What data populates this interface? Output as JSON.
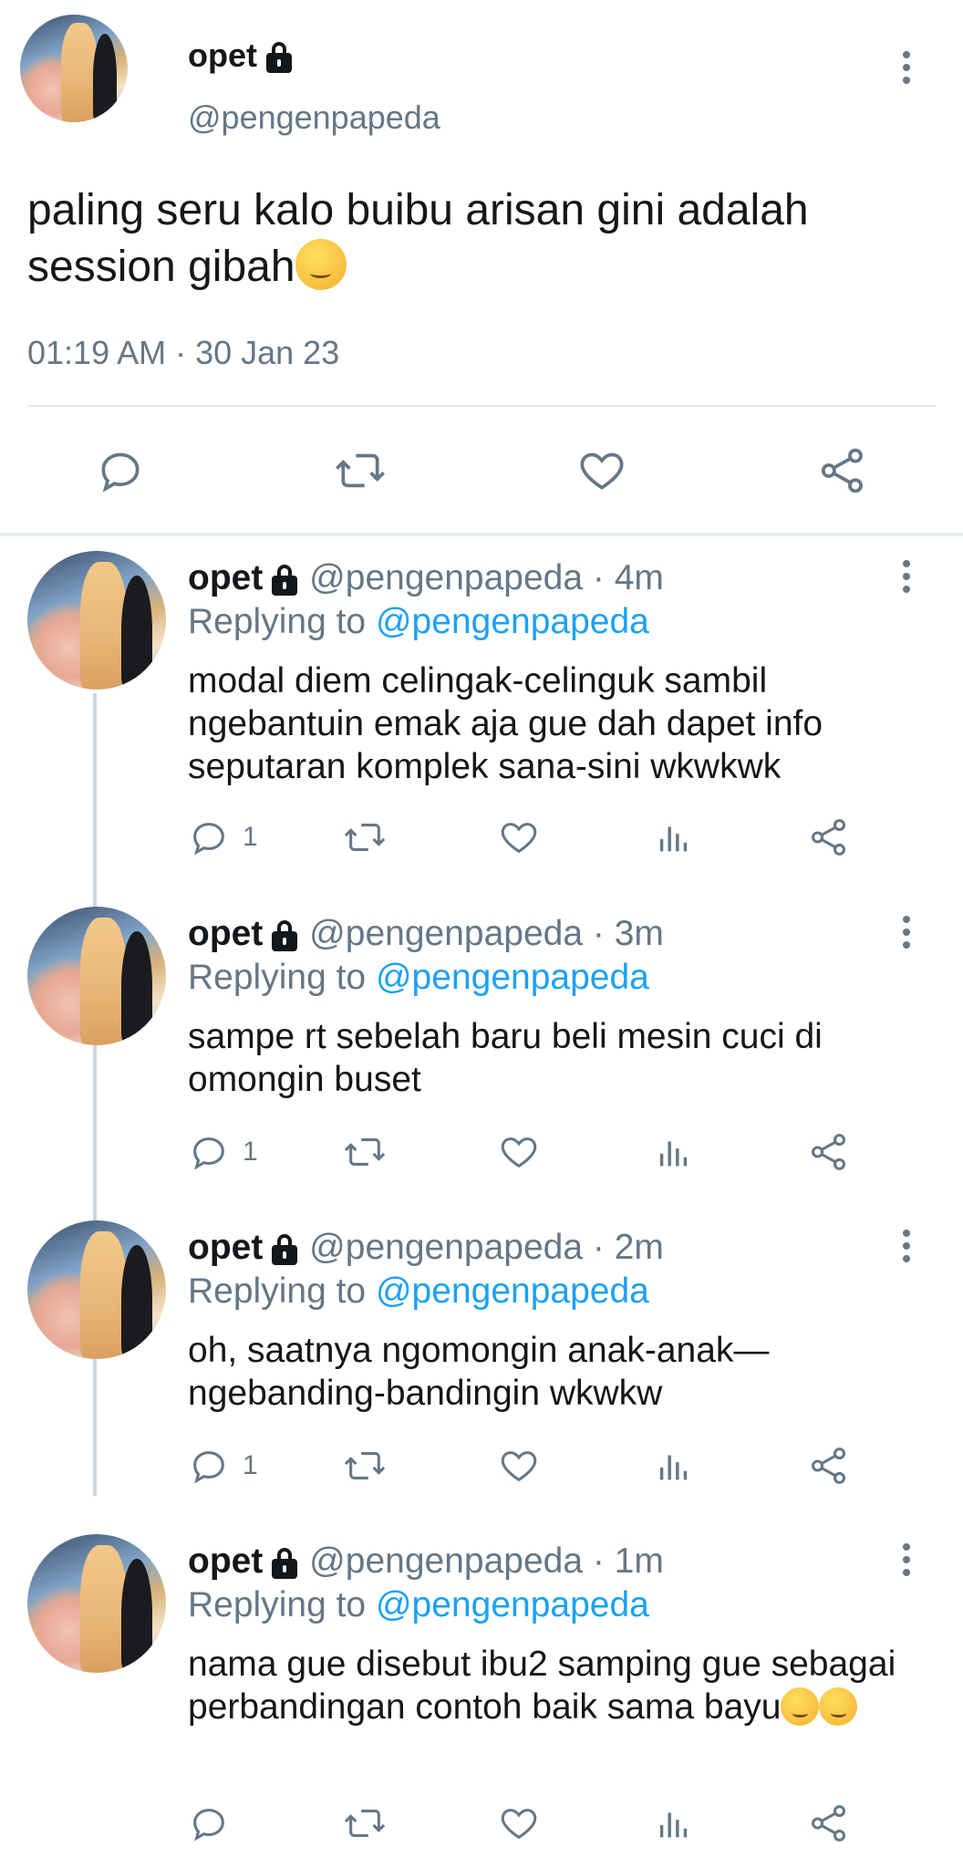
{
  "main_tweet": {
    "name": "opet",
    "handle": "@pengenpapeda",
    "text": "paling seru kalo buibu arisan gini adalah session gibah",
    "emoji": "drooling-face",
    "timestamp": "01:19 AM · 30 Jan 23",
    "actions": [
      "reply-icon",
      "retweet-icon",
      "like-icon",
      "share-icon"
    ]
  },
  "replies": [
    {
      "name": "opet",
      "handle": "@pengenpapeda · 4m",
      "replying_prefix": "Replying to",
      "replying_to": "@pengenpapeda",
      "text": "modal diem celingak-celinguk sambil ngebantuin emak aja gue dah dapet info seputaran komplek sana-sini wkwkwk",
      "reply_count": "1"
    },
    {
      "name": "opet",
      "handle": "@pengenpapeda · 3m",
      "replying_prefix": "Replying to",
      "replying_to": "@pengenpapeda",
      "text": "sampe rt sebelah baru beli mesin cuci di omongin buset",
      "reply_count": "1"
    },
    {
      "name": "opet",
      "handle": "@pengenpapeda · 2m",
      "replying_prefix": "Replying to",
      "replying_to": "@pengenpapeda",
      "text": "oh, saatnya ngomongin anak-anak—ngebanding-bandingin wkwkw",
      "reply_count": "1"
    },
    {
      "name": "opet",
      "handle": "@pengenpapeda · 1m",
      "replying_prefix": "Replying to",
      "replying_to": "@pengenpapeda",
      "text": "nama gue disebut ibu2 samping gue sebagai perbandingan contoh baik sama bayu",
      "reply_count": ""
    }
  ],
  "colors": {
    "text": "#14171a",
    "secondary": "#657786",
    "link": "#1da1f2",
    "divider": "#e1e8ed"
  }
}
